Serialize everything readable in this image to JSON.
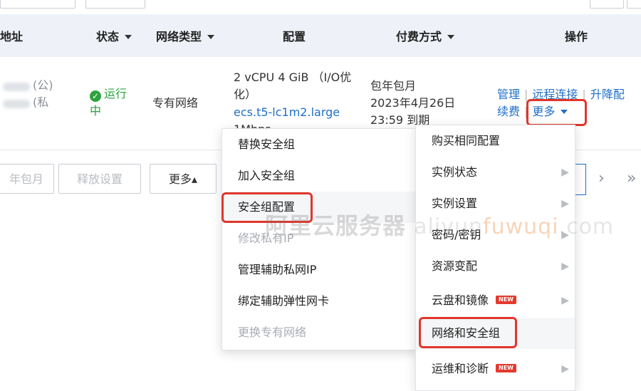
{
  "table": {
    "headers": {
      "address": "地址",
      "status": "状态",
      "network_type": "网络类型",
      "config": "配置",
      "payment": "付费方式",
      "actions": "操作"
    },
    "row": {
      "ip_public_suffix": "(公)",
      "ip_private_suffix": "(私",
      "status_line1": "运行",
      "status_line2": "中",
      "network_type": "专有网络",
      "config_line1": "2 vCPU 4 GiB （I/O优",
      "config_line2": "化）",
      "instance_type": "ecs.t5-lc1m2.large",
      "bandwidth": "1Mbps",
      "payment_line1": "包年包月",
      "payment_line2": "2023年4月26日",
      "payment_line3": "23:59 到期",
      "action_manage": "管理",
      "action_remote": "远程连接",
      "action_upgrade": "升降配",
      "action_renew": "续费",
      "action_more": "更多"
    }
  },
  "footer": {
    "renew_btn": "年包月",
    "release_btn": "释放设置",
    "more_btn": "更多▴",
    "next": "›",
    "last": "»"
  },
  "left_menu": {
    "items": [
      {
        "label": "替换安全组",
        "disabled": false
      },
      {
        "label": "加入安全组",
        "disabled": false
      },
      {
        "label": "安全组配置",
        "disabled": false
      },
      {
        "label": "修改私有IP",
        "disabled": true
      },
      {
        "label": "管理辅助私网IP",
        "disabled": false
      },
      {
        "label": "绑定辅助弹性网卡",
        "disabled": false
      },
      {
        "label": "更换专有网络",
        "disabled": true
      }
    ]
  },
  "right_menu": {
    "new_badge": "NEW",
    "items": [
      {
        "label": "购买相同配置"
      },
      {
        "label": "实例状态"
      },
      {
        "label": "实例设置"
      },
      {
        "label": "密码/密钥"
      },
      {
        "label": "资源变配"
      },
      {
        "label": "云盘和镜像"
      },
      {
        "label": "网络和安全组"
      },
      {
        "label": "运维和诊断"
      }
    ]
  },
  "watermark": {
    "cn": "阿里云服务器",
    "en_prefix": "aliyun",
    "en_mid": "fuwuqi",
    "en_suffix": ".com"
  },
  "colors": {
    "accent_link": "#1f6fc7",
    "highlight_red": "#e0362c",
    "running_green": "#2ea33f",
    "header_bg": "#eef2f8"
  }
}
